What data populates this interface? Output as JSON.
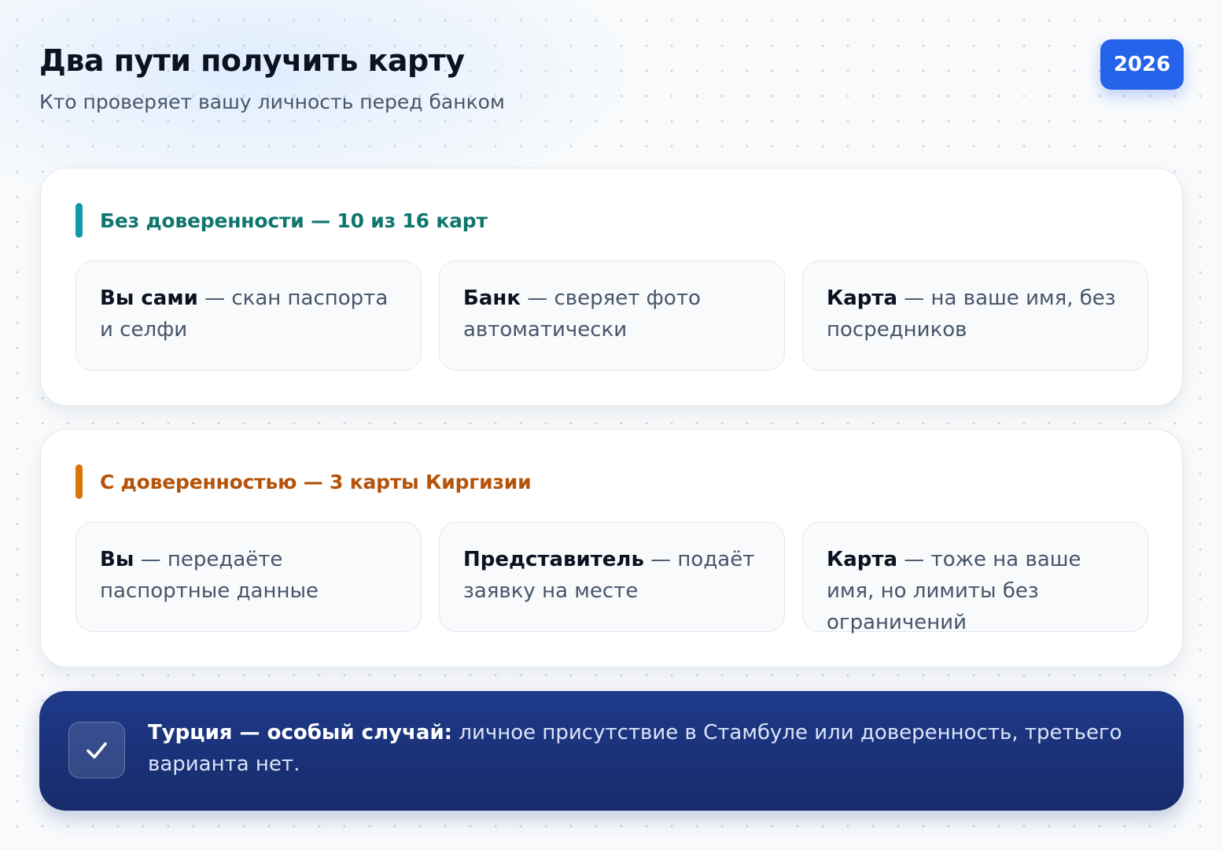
{
  "header": {
    "title": "Два пути получить карту",
    "subtitle": "Кто проверяет вашу личность перед банком",
    "badge": "2026"
  },
  "sections": [
    {
      "title": "Без доверенности — 10 из 16 карт",
      "accent": "#0e9aa7",
      "tiles": [
        {
          "bold": "Вы сами",
          "text": " — скан паспорта и селфи"
        },
        {
          "bold": "Банк",
          "text": " — сверяет фото автоматически"
        },
        {
          "bold": "Карта",
          "text": " — на ваше имя, без посредников"
        }
      ]
    },
    {
      "title": "С доверенностью — 3 карты Киргизии",
      "accent": "#d97706",
      "tiles": [
        {
          "bold": "Вы",
          "text": " — передаёте паспортные данные"
        },
        {
          "bold": "Представитель",
          "text": " — подаёт заявку на месте"
        },
        {
          "bold": "Карта",
          "text": " — тоже на ваше имя, но лимиты без ограничений"
        }
      ]
    }
  ],
  "note": {
    "icon": "check-icon",
    "bold": "Турция — особый случай:",
    "text": " личное присутствие в Стамбуле или доверенность, третьего варианта нет."
  },
  "colors": {
    "badge": "#2563eb",
    "note_bg": "#1e3a8a",
    "teal": "#0f766e",
    "orange": "#b45309"
  }
}
